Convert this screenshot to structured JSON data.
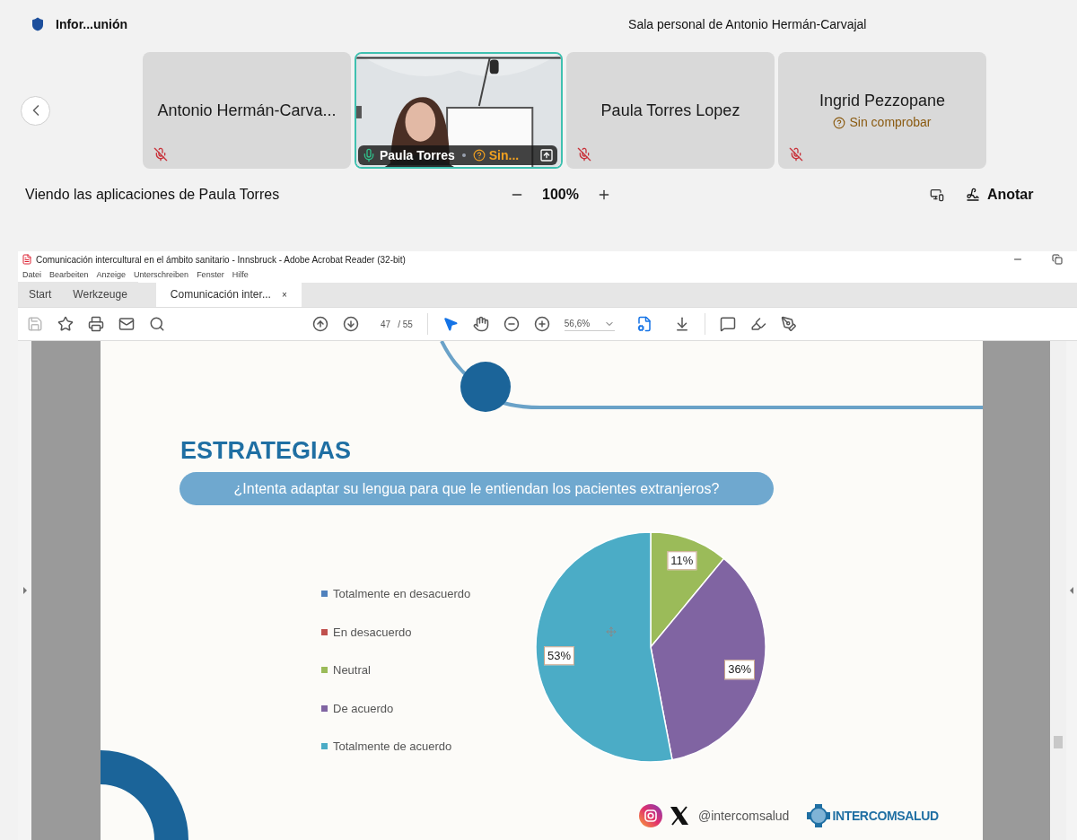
{
  "meeting": {
    "title": "Infor...unión",
    "room": "Sala personal de Antonio Hermán-Carvajal"
  },
  "participants": [
    {
      "kind": "name",
      "name": "Antonio Hermán-Carva...",
      "muted": true,
      "active_speaker": false
    },
    {
      "kind": "video",
      "name": "Paula Torres",
      "status": "Sin...",
      "muted": false,
      "active_speaker": true
    },
    {
      "kind": "name",
      "name": "Paula Torres Lopez",
      "muted": true,
      "active_speaker": false
    },
    {
      "kind": "name",
      "name": "Ingrid Pezzopane",
      "status": "Sin comprobar",
      "muted": true,
      "active_speaker": false
    }
  ],
  "share_bar": {
    "label": "Viendo las aplicaciones de Paula Torres",
    "zoom": "100%",
    "annotate": "Anotar"
  },
  "acrobat": {
    "title": "Comunicación intercultural en el ámbito sanitario - Innsbruck - Adobe Acrobat Reader (32-bit)",
    "menu": [
      "Datei",
      "Bearbeiten",
      "Anzeige",
      "Unterschreiben",
      "Fenster",
      "Hilfe"
    ],
    "tabs": [
      {
        "label": "Start",
        "selected": false
      },
      {
        "label": "Werkzeuge",
        "selected": false
      },
      {
        "label": "Comunicación inter...",
        "selected": true,
        "close": "×"
      }
    ],
    "page": "47",
    "page_total": "/ 55",
    "zoom": "56,6%"
  },
  "slide": {
    "title": "ESTRATEGIAS",
    "question": "¿Intenta adaptar su lengua para que le entiendan los pacientes extranjeros?",
    "chart_data": {
      "type": "pie",
      "data_labels": true,
      "categories": [
        "Totalmente en desacuerdo",
        "En desacuerdo",
        "Neutral",
        "De acuerdo",
        "Totalmente de acuerdo"
      ],
      "values": [
        0,
        0,
        11,
        36,
        53
      ],
      "colors": [
        "#4f81bd",
        "#c0504d",
        "#9bbb59",
        "#8064a2",
        "#4bacc6"
      ],
      "value_labels": [
        null,
        null,
        "11%",
        "36%",
        "53%"
      ]
    },
    "handle": "@intercomsalud",
    "logo_text": "INTERCOMSALUD"
  }
}
